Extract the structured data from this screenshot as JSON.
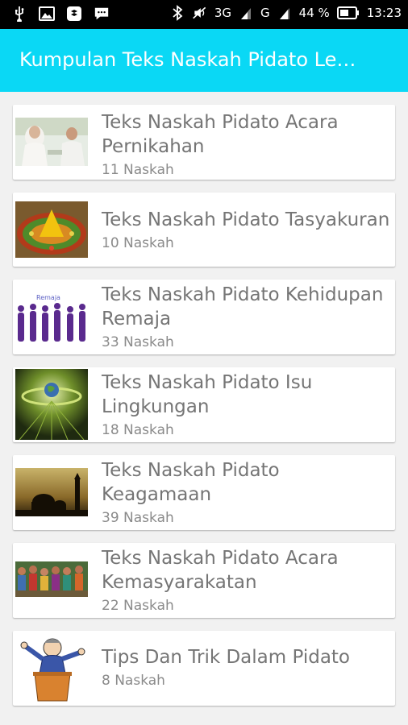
{
  "status_bar": {
    "network": "3G",
    "network2": "G",
    "battery": "44 %",
    "time": "13:23",
    "icons": [
      "usb-icon",
      "image-icon",
      "dropbox-icon",
      "chat-icon",
      "bluetooth-icon",
      "mute-icon",
      "signal-icon",
      "battery-icon"
    ]
  },
  "app_bar": {
    "title": "Kumpulan Teks Naskah Pidato Le…"
  },
  "items": [
    {
      "title": "Teks Naskah Pidato Acara Pernikahan",
      "count": "11 Naskah",
      "image": "wedding-image"
    },
    {
      "title": "Teks Naskah Pidato Tasyakuran",
      "count": "10 Naskah",
      "image": "tumpeng-image"
    },
    {
      "title": "Teks Naskah Pidato Kehidupan Remaja",
      "count": "33 Naskah",
      "image": "teenagers-image",
      "image_caption": "Remaja"
    },
    {
      "title": "Teks Naskah Pidato Isu Lingkungan",
      "count": "18 Naskah",
      "image": "globe-environment-image"
    },
    {
      "title": "Teks Naskah Pidato Keagamaan",
      "count": "39 Naskah",
      "image": "mosque-sunset-image"
    },
    {
      "title": "Teks Naskah Pidato Acara Kemasyarakatan",
      "count": "22 Naskah",
      "image": "crowd-image"
    },
    {
      "title": "Tips Dan Trik Dalam Pidato",
      "count": "8 Naskah",
      "image": "speaker-podium-image"
    }
  ]
}
